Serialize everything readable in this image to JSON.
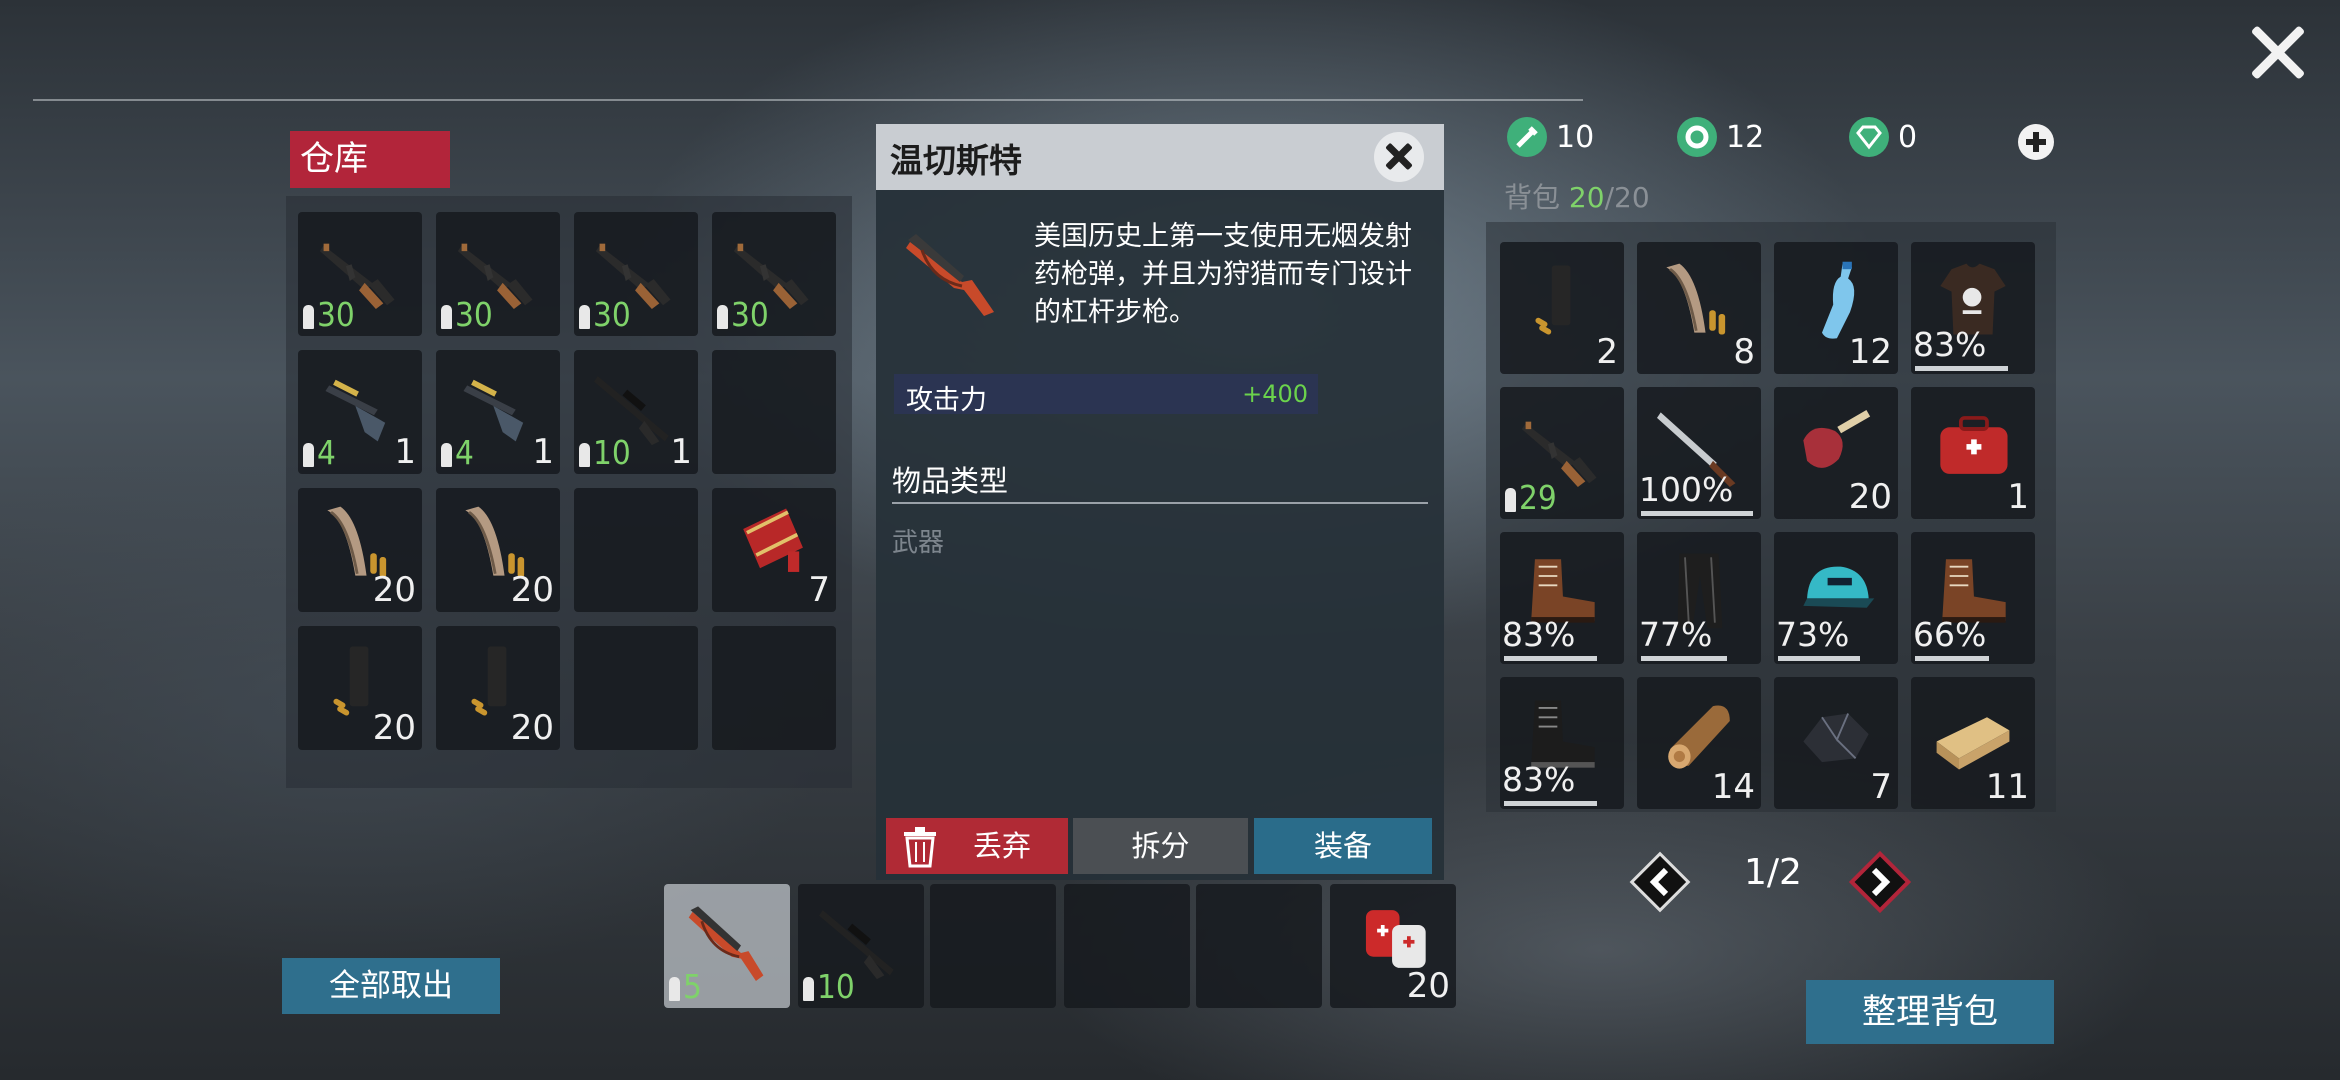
{
  "colors": {
    "accent_red": "#b2253a",
    "accent_blue": "#2f6f8d",
    "ammo_green": "#7fd26a",
    "stat_green": "#6bd34c"
  },
  "currency": [
    {
      "icon": "green-wrench-coin-icon",
      "value": "10"
    },
    {
      "icon": "green-gear-coin-icon",
      "value": "12"
    },
    {
      "icon": "green-diamond-icon",
      "value": "0"
    }
  ],
  "backpack": {
    "label": "背包",
    "used": "20",
    "sep": "/",
    "cap": "20",
    "page": "1/2"
  },
  "warehouse": {
    "title": "仓库",
    "take_all": "全部取出",
    "items": [
      {
        "icon": "ak47-rifle-icon",
        "ammo": "30"
      },
      {
        "icon": "ak47-rifle-icon",
        "ammo": "30"
      },
      {
        "icon": "ak47-rifle-icon",
        "ammo": "30"
      },
      {
        "icon": "ak47-rifle-icon",
        "ammo": "30"
      },
      {
        "icon": "shotgun-icon",
        "ammo": "4",
        "qty": "1"
      },
      {
        "icon": "shotgun-icon",
        "ammo": "4",
        "qty": "1"
      },
      {
        "icon": "sniper-rifle-icon",
        "ammo": "10",
        "qty": "1"
      },
      {
        "icon": "empty"
      },
      {
        "icon": "rifle-magazine-icon",
        "qty": "20"
      },
      {
        "icon": "rifle-magazine-icon",
        "qty": "20"
      },
      {
        "icon": "empty"
      },
      {
        "icon": "shotgun-shells-icon",
        "qty": "7"
      },
      {
        "icon": "pistol-magazine-icon",
        "qty": "20"
      },
      {
        "icon": "pistol-magazine-icon",
        "qty": "20"
      },
      {
        "icon": "empty"
      },
      {
        "icon": "empty"
      }
    ]
  },
  "detail": {
    "title": "温切斯特",
    "icon": "winchester-rifle-icon",
    "description": "美国历史上第一支使用无烟发射药枪弹，并且为狩猎而专门设计的杠杆步枪。",
    "stat_label": "攻击力",
    "stat_value": "+400",
    "type_heading": "物品类型",
    "type_value": "武器",
    "drop": "丢弃",
    "split": "拆分",
    "equip": "装备"
  },
  "quickbar": [
    {
      "icon": "winchester-rifle-icon",
      "ammo": "5",
      "selected": true
    },
    {
      "icon": "sniper-rifle-icon",
      "ammo": "10"
    },
    {
      "icon": "empty"
    },
    {
      "icon": "empty"
    },
    {
      "icon": "empty"
    },
    {
      "icon": "first-aid-kit-can-icon",
      "qty": "20"
    }
  ],
  "backpack_items": [
    {
      "icon": "pistol-magazine-icon",
      "qty": "2"
    },
    {
      "icon": "rifle-magazine-icon",
      "qty": "8"
    },
    {
      "icon": "water-bottle-icon",
      "qty": "12"
    },
    {
      "icon": "tshirt-icon",
      "pct": "83%"
    },
    {
      "icon": "ak47-rifle-icon",
      "ammo": "29"
    },
    {
      "icon": "machete-icon",
      "pct": "100%"
    },
    {
      "icon": "ham-leg-icon",
      "qty": "20"
    },
    {
      "icon": "medical-bag-icon",
      "qty": "1"
    },
    {
      "icon": "brown-boots-icon",
      "pct": "83%"
    },
    {
      "icon": "leather-pants-icon",
      "pct": "77%"
    },
    {
      "icon": "cap-icon",
      "pct": "73%"
    },
    {
      "icon": "brown-boots-icon",
      "pct": "66%"
    },
    {
      "icon": "black-boots-icon",
      "pct": "83%"
    },
    {
      "icon": "wood-log-icon",
      "qty": "14"
    },
    {
      "icon": "coal-ore-icon",
      "qty": "7"
    },
    {
      "icon": "wood-plank-icon",
      "qty": "11"
    }
  ],
  "tidy_button": "整理背包"
}
